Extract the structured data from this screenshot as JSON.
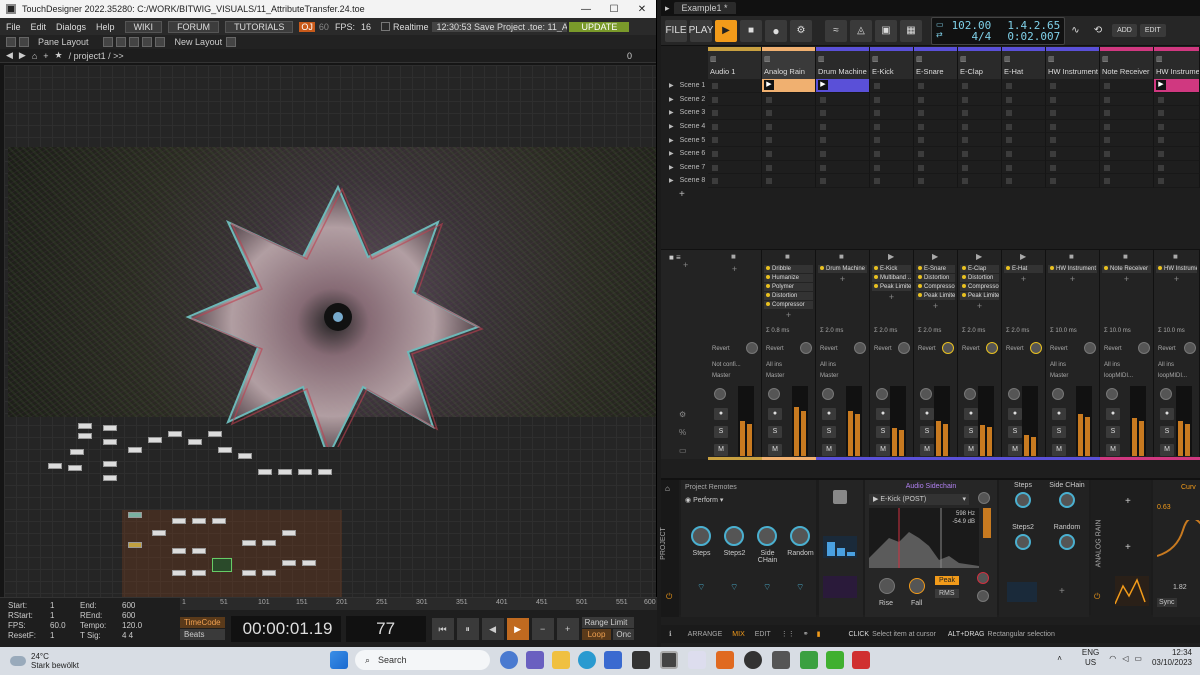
{
  "touchdesigner": {
    "title": "TouchDesigner 2022.35280: C:/WORK/BITWIG_VISUALS/11_AttributeTransfer.24.toe",
    "menu": [
      "File",
      "Edit",
      "Dialogs",
      "Help"
    ],
    "links": [
      "WIKI",
      "FORUM",
      "TUTORIALS"
    ],
    "oj_label": "OJ",
    "fps_value_dim": "60",
    "fps_label": "FPS:",
    "fps_value": "16",
    "realtime_label": "Realtime",
    "status_text": "12:30:53 Save Project .toe: 11_At",
    "update_label": "UPDATE",
    "pane_layout": "Pane Layout",
    "new_layout": "New Layout",
    "path": "/ project1 / >>",
    "path_count": "0",
    "stats": [
      {
        "k": "Start:",
        "v": "1",
        "k2": "End:",
        "v2": "600"
      },
      {
        "k": "RStart:",
        "v": "1",
        "k2": "REnd:",
        "v2": "600"
      },
      {
        "k": "FPS:",
        "v": "60.0",
        "k2": "Tempo:",
        "v2": "120.0"
      },
      {
        "k": "ResetF:",
        "v": "1",
        "k2": "T Sig:",
        "v2": "4    4"
      }
    ],
    "ruler": [
      "1",
      "51",
      "101",
      "151",
      "201",
      "251",
      "301",
      "351",
      "401",
      "451",
      "501",
      "551",
      "600"
    ],
    "timecode_label": "TimeCode",
    "beats_label": "Beats",
    "timecode": "00:00:01.19",
    "frame": "77",
    "range_limit": "Range Limit",
    "loop_label": "Loop",
    "once_label": "Onc"
  },
  "bitwig": {
    "tab": "Example1 *",
    "file_label": "FILE",
    "play_label": "PLAY",
    "tempo": "102.00",
    "timesig": "4/4",
    "position": "1.4.2.65",
    "time": "0:02.007",
    "add_label": "ADD",
    "edit_label": "EDIT",
    "tracks": [
      {
        "name": "Audio 1",
        "color": "#c8a040"
      },
      {
        "name": "Analog Rain",
        "color": "#f0b070"
      },
      {
        "name": "Drum Machine",
        "color": "#5a50d8"
      },
      {
        "name": "E-Kick",
        "color": "#5a50d8"
      },
      {
        "name": "E-Snare",
        "color": "#5a50d8"
      },
      {
        "name": "E-Clap",
        "color": "#5a50d8"
      },
      {
        "name": "E-Hat",
        "color": "#5a50d8"
      },
      {
        "name": "HW Instrument",
        "color": "#5a50d8"
      },
      {
        "name": "Note Receiver",
        "color": "#d03880"
      },
      {
        "name": "HW Instrument",
        "color": "#d03880"
      }
    ],
    "scenes": [
      "Scene 1",
      "Scene 2",
      "Scene 3",
      "Scene 4",
      "Scene 5",
      "Scene 6",
      "Scene 7",
      "Scene 8"
    ],
    "fx_chains": [
      [],
      [
        "Dribble",
        "Humanize",
        "Polymer",
        "Distortion",
        "Compressor"
      ],
      [
        "Drum Machine"
      ],
      [
        "E-Kick",
        "Multiband ...",
        "Peak Limiter"
      ],
      [
        "E-Snare",
        "Distortion",
        "Compressor",
        "Peak Limiter"
      ],
      [
        "E-Clap",
        "Distortion",
        "Compressor",
        "Peak Limiter"
      ],
      [
        "E-Hat"
      ],
      [
        "HW Instrument"
      ],
      [
        "Note Receiver"
      ],
      [
        "HW Instrument"
      ]
    ],
    "latencies": [
      "",
      "Σ 0.8 ms",
      "Σ 2.0 ms",
      "Σ 2.0 ms",
      "Σ 2.0 ms",
      "Σ 2.0 ms",
      "Σ 2.0 ms",
      "Σ 10.0 ms",
      "Σ 10.0 ms",
      "Σ 10.0 ms"
    ],
    "inputs": [
      "Not confi...",
      "All ins",
      "All ins",
      "",
      "",
      "",
      "",
      "All ins",
      "All ins",
      "All ins"
    ],
    "outputs": [
      "Master",
      "Master",
      "Master",
      "",
      "",
      "",
      "",
      "Master",
      "loopMIDI...",
      "loopMIDI..."
    ],
    "revert_label": "Revert",
    "s_label": "S",
    "m_label": "M",
    "device": {
      "remotes_title": "Project Remotes",
      "perform": "Perform",
      "knobs": [
        "Steps",
        "Steps2",
        "Side CHain",
        "Random"
      ],
      "sidechain_title": "Audio Sidechain",
      "sidechain_source": "E-Kick (POST)",
      "freq": "598 Hz",
      "db": "-54.9 dB",
      "rise": "Rise",
      "fall": "Fall",
      "peak": "Peak",
      "rms": "RMS",
      "right_knobs": [
        "Steps",
        "Side CHain",
        "Steps2",
        "Random"
      ],
      "project_label": "PROJECT",
      "analog_rain_label": "ANALOG RAIN",
      "curve_label": "Curv",
      "val1": "0.63",
      "val2": "1.82",
      "sync": "Sync"
    },
    "status": {
      "arrange": "ARRANGE",
      "mix": "MIX",
      "edit": "EDIT",
      "click": "CLICK",
      "click_desc": "Select item at cursor",
      "altdrag": "ALT+DRAG",
      "altdrag_desc": "Rectangular selection"
    }
  },
  "taskbar": {
    "temp": "24°C",
    "weather": "Stark bewölkt",
    "search": "Search",
    "lang": "ENG",
    "region": "US",
    "time": "12:34",
    "date": "03/10/2023"
  }
}
